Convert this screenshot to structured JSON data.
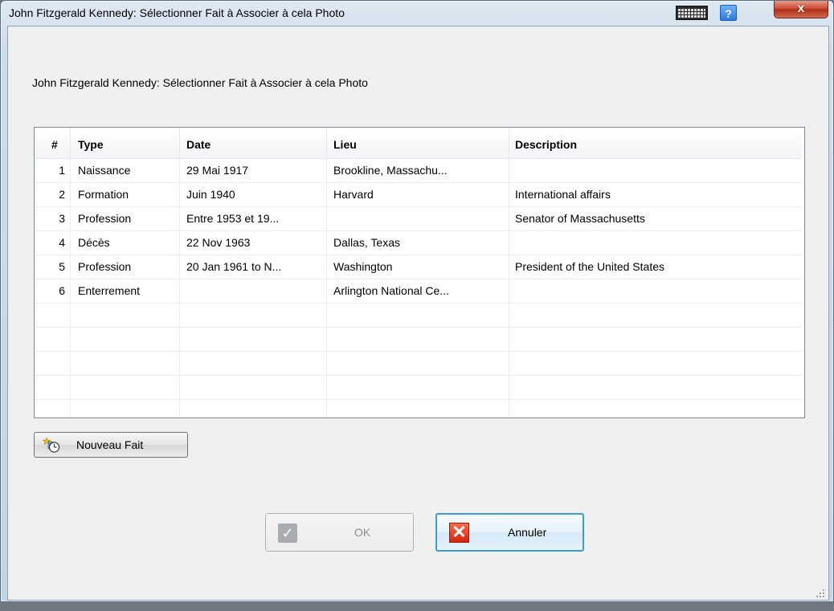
{
  "window": {
    "title": "John Fitzgerald Kennedy: Sélectionner Fait à Associer à cela Photo",
    "close_glyph": "x",
    "help_glyph": "?"
  },
  "heading": "John Fitzgerald Kennedy: Sélectionner Fait à Associer à cela Photo",
  "table": {
    "columns": [
      "#",
      "Type",
      "Date",
      "Lieu",
      "Description"
    ],
    "rows": [
      {
        "num": "1",
        "type": "Naissance",
        "date": "29 Mai 1917",
        "place": "Brookline, Massachu...",
        "desc": ""
      },
      {
        "num": "2",
        "type": "Formation",
        "date": "Juin 1940",
        "place": "Harvard",
        "desc": "International affairs"
      },
      {
        "num": "3",
        "type": "Profession",
        "date": "Entre 1953 et 19...",
        "place": "",
        "desc": "Senator of Massachusetts"
      },
      {
        "num": "4",
        "type": "Décès",
        "date": "22 Nov 1963",
        "place": "Dallas, Texas",
        "desc": ""
      },
      {
        "num": "5",
        "type": "Profession",
        "date": "20 Jan 1961 to N...",
        "place": "Washington",
        "desc": "President of the United States"
      },
      {
        "num": "6",
        "type": "Enterrement",
        "date": "",
        "place": "Arlington National Ce...",
        "desc": ""
      }
    ]
  },
  "buttons": {
    "new_fact": "Nouveau Fait",
    "ok": "OK",
    "ok_glyph": "✓",
    "cancel": "Annuler",
    "cancel_glyph": "✕"
  },
  "colors": {
    "cancel_focus_border": "#3c9ad6",
    "close_button_red": "#c7432c",
    "help_blue": "#2a78e0"
  }
}
